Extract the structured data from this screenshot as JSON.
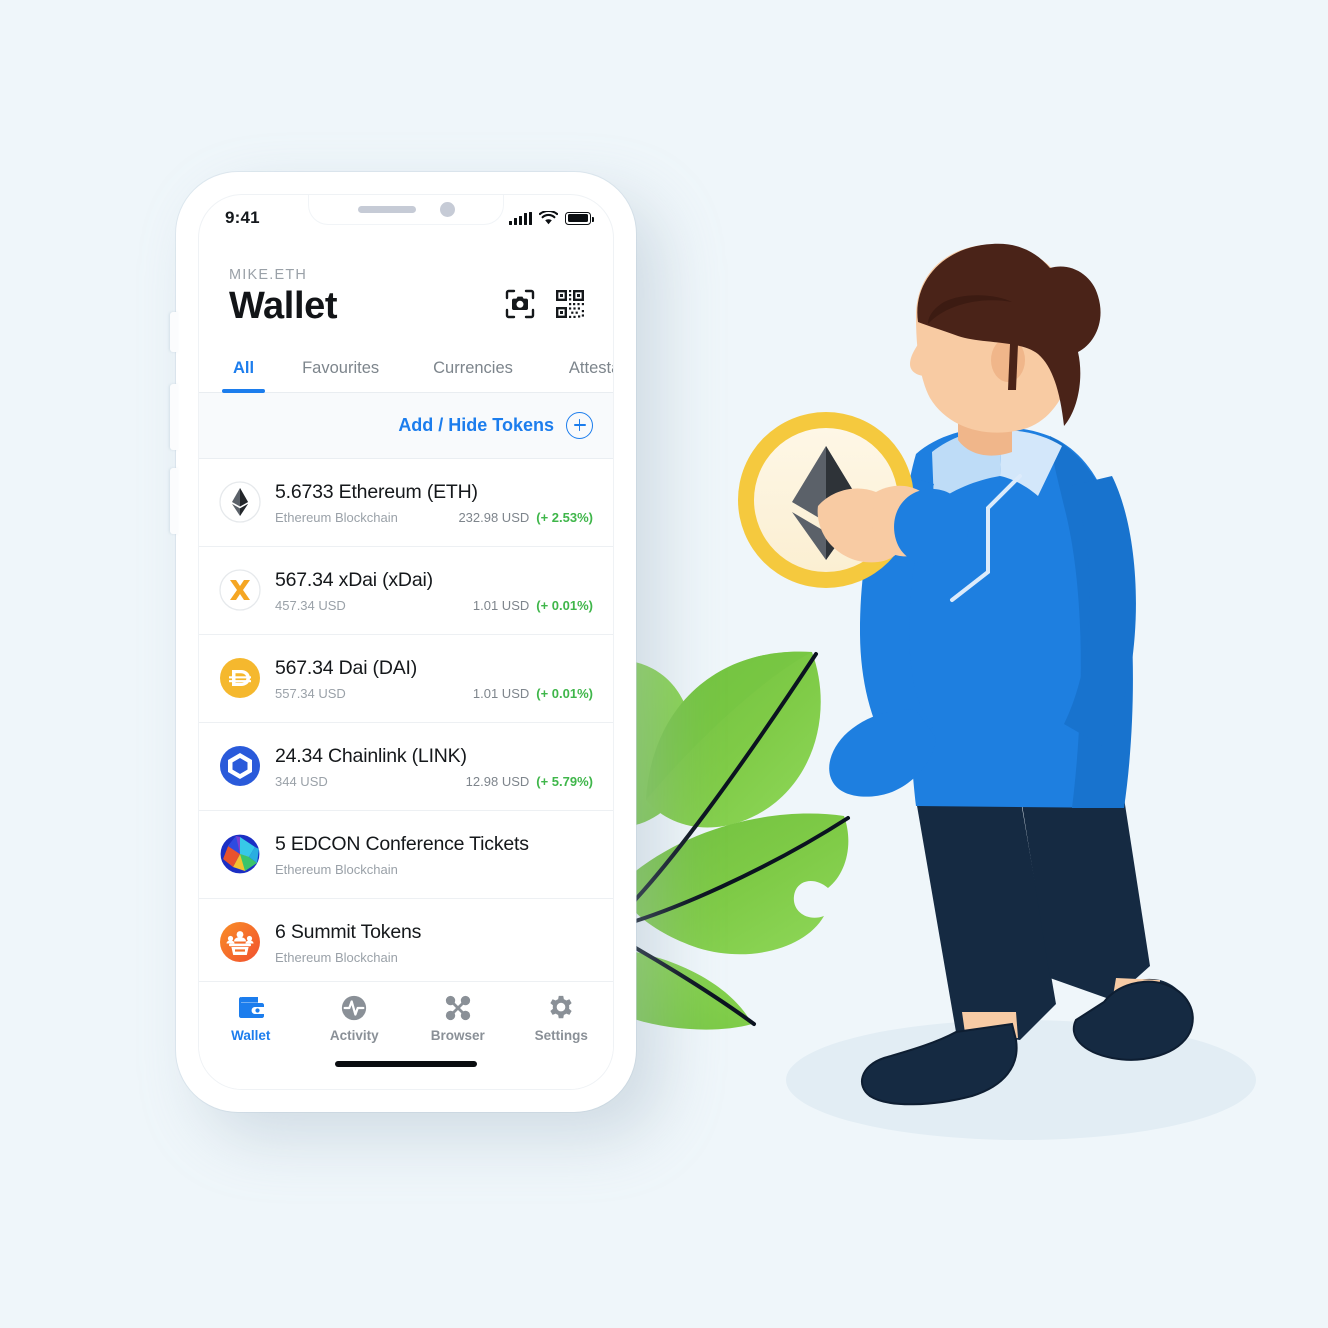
{
  "background_color": "#EFF6FA",
  "accent_color": "#1C7DED",
  "positive_color": "#3FB64A",
  "status_bar": {
    "time": "9:41",
    "signal_icon": "signal-bars-icon",
    "wifi_icon": "wifi-icon",
    "battery_icon": "battery-full-icon"
  },
  "header": {
    "eyebrow": "MIKE.ETH",
    "title": "Wallet",
    "scan_icon": "camera-scan-icon",
    "qr_icon": "qr-code-icon"
  },
  "tabs": [
    {
      "label": "All",
      "active": true
    },
    {
      "label": "Favourites",
      "active": false
    },
    {
      "label": "Currencies",
      "active": false
    },
    {
      "label": "Attestatio",
      "active": false
    }
  ],
  "add_hide": {
    "label": "Add / Hide Tokens",
    "icon": "plus-circle-icon"
  },
  "tokens": [
    {
      "icon": "ethereum-icon",
      "title": "5.6733 Ethereum (ETH)",
      "chain": "Ethereum Blockchain",
      "price": "232.98 USD",
      "change": "(+ 2.53%)"
    },
    {
      "icon": "xdai-icon",
      "title": "567.34 xDai (xDai)",
      "chain": "457.34 USD",
      "price": "1.01 USD",
      "change": "(+ 0.01%)"
    },
    {
      "icon": "dai-icon",
      "title": "567.34 Dai (DAI)",
      "chain": "557.34 USD",
      "price": "1.01 USD",
      "change": "(+ 0.01%)"
    },
    {
      "icon": "chainlink-icon",
      "title": "24.34 Chainlink (LINK)",
      "chain": "344 USD",
      "price": "12.98 USD",
      "change": "(+ 5.79%)"
    },
    {
      "icon": "edcon-icon",
      "title": "5 EDCON Conference Tickets",
      "chain": "Ethereum Blockchain",
      "price": "",
      "change": ""
    },
    {
      "icon": "summit-icon",
      "title": "6 Summit Tokens",
      "chain": "Ethereum Blockchain",
      "price": "",
      "change": ""
    }
  ],
  "tabbar": [
    {
      "label": "Wallet",
      "icon": "wallet-icon",
      "active": true
    },
    {
      "label": "Activity",
      "icon": "activity-pulse-icon",
      "active": false
    },
    {
      "label": "Browser",
      "icon": "browser-nodes-icon",
      "active": false
    },
    {
      "label": "Settings",
      "icon": "gear-icon",
      "active": false
    }
  ],
  "illustration": {
    "coin_icon": "ethereum-coin-icon",
    "character": "man-walking-holding-coin",
    "plant": "leafy-branch"
  }
}
